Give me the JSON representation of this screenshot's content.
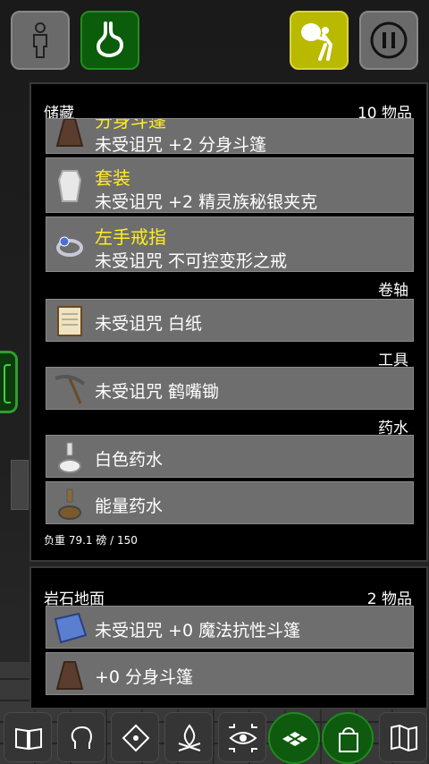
{
  "inventory": {
    "title": "储藏",
    "count": "10 物品",
    "items_cloak_partial": {
      "name": "分身斗篷",
      "desc": "未受诅咒 +2 分身斗篷"
    },
    "armor": {
      "name": "套装",
      "desc": "未受诅咒 +2 精灵族秘银夹克"
    },
    "ring": {
      "name": "左手戒指",
      "desc": "未受诅咒 不可控变形之戒"
    },
    "sections": {
      "scrolls": "卷轴",
      "tools": "工具",
      "potions": "药水"
    },
    "scroll_item": "未受诅咒 白纸",
    "tool_item": "未受诅咒 鹤嘴锄",
    "potion_items": [
      "白色药水",
      "能量药水"
    ],
    "weight": "负重 79.1 磅 / 150"
  },
  "floor": {
    "title": "岩石地面",
    "count": "2 物品",
    "items": [
      "未受诅咒 +0 魔法抗性斗篷",
      "+0 分身斗篷"
    ]
  },
  "icons": {
    "top": [
      "person-icon",
      "stomach-icon",
      "burden-icon",
      "pause-icon"
    ],
    "bottom": [
      "spellbook-icon",
      "head-icon",
      "trap-icon",
      "campfire-icon",
      "search-eye-icon",
      "floor-tile-icon",
      "inventory-icon",
      "map-icon"
    ]
  },
  "colors": {
    "item_name": "#ffee22",
    "green_button": "#0e5a0e",
    "burden_button": "#b9b900"
  }
}
